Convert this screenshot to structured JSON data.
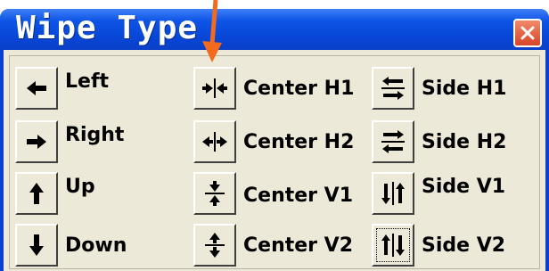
{
  "window": {
    "title": "Wipe Type",
    "close_icon": "close-icon"
  },
  "options": {
    "left": "Left",
    "right": "Right",
    "up": "Up",
    "down": "Down",
    "center_h1": "Center H1",
    "center_h2": "Center H2",
    "center_v1": "Center V1",
    "center_v2": "Center V2",
    "side_h1": "Side H1",
    "side_h2": "Side H2",
    "side_v1": "Side V1",
    "side_v2": "Side V2"
  },
  "colors": {
    "titlebar": "#0846d6",
    "close_button": "#d9442a",
    "annotation_arrow": "#f26a1b",
    "face": "#ece9d8"
  }
}
